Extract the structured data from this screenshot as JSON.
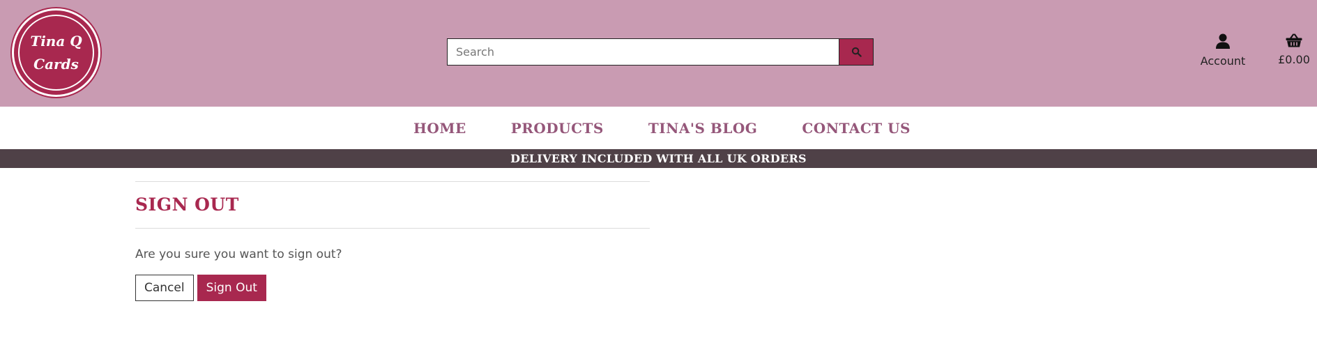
{
  "brand": {
    "line1": "Tina Q",
    "line2": "Cards"
  },
  "search": {
    "placeholder": "Search"
  },
  "header": {
    "account_label": "Account",
    "basket_total": "£0.00"
  },
  "nav": {
    "items": [
      {
        "label": "Home"
      },
      {
        "label": "Products"
      },
      {
        "label": "Tina's Blog"
      },
      {
        "label": "Contact Us"
      }
    ]
  },
  "banner": {
    "text": "DELIVERY INCLUDED WITH ALL UK ORDERS"
  },
  "page": {
    "title": "SIGN OUT",
    "question": "Are you sure you want to sign out?",
    "cancel_label": "Cancel",
    "signout_label": "Sign Out"
  },
  "colors": {
    "header_bg": "#c99bb2",
    "brand": "#a8284f",
    "nav_text": "#95577a",
    "banner_bg": "#4f4147"
  },
  "icons": {
    "search": "search-icon",
    "account": "user-icon",
    "basket": "basket-icon"
  }
}
